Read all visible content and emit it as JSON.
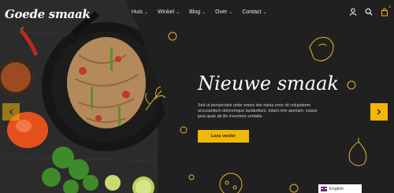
{
  "header": {
    "logo": "Goede smaak",
    "nav": [
      {
        "label": "Huis",
        "has_dropdown": true
      },
      {
        "label": "Winkel",
        "has_dropdown": true
      },
      {
        "label": "Blog",
        "has_dropdown": true
      },
      {
        "label": "Over",
        "has_dropdown": true
      },
      {
        "label": "Contact",
        "has_dropdown": true
      }
    ],
    "icons": [
      "user-icon",
      "search-icon",
      "cart-icon"
    ],
    "cart_count": "0"
  },
  "slide": {
    "title": "Nieuwe smaak",
    "text": "Sed ut perspiciatis unde omnis iste natus error sit voluptatem accusantium doloremque laudantium, totam rem aperiam, eaque ipsa quae ab illo inventore veritatis.",
    "button_label": "Lees verder"
  },
  "language": {
    "label": "English"
  },
  "colors": {
    "accent": "#f2b705",
    "background": "#202020"
  }
}
